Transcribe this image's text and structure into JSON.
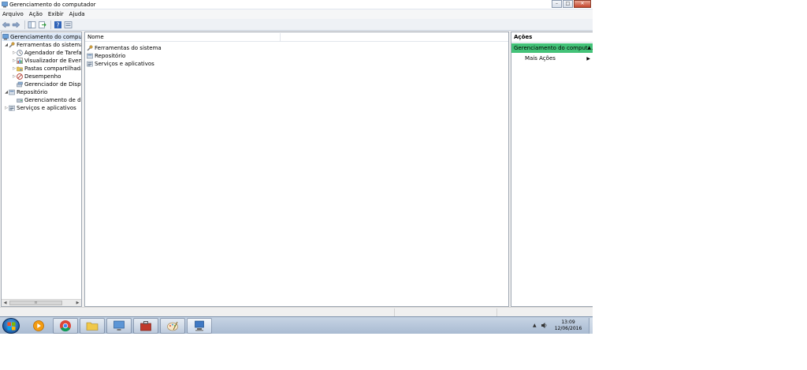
{
  "window": {
    "title": "Gerenciamento do computador",
    "buttons": {
      "minimize": "–",
      "maximize": "□",
      "close": "✕"
    }
  },
  "menu": [
    "Arquivo",
    "Ação",
    "Exibir",
    "Ajuda"
  ],
  "toolbar": {
    "icons": [
      "back-arrow-icon",
      "forward-arrow-icon",
      "show-hide-tree-icon",
      "export-list-icon",
      "help-icon",
      "properties-icon"
    ]
  },
  "tree": {
    "root": "Gerenciamento do computado",
    "items": [
      {
        "label": "Ferramentas do sistema",
        "level": 1,
        "expanded": true,
        "icon": "tools-icon"
      },
      {
        "label": "Agendador de Tarefas",
        "level": 2,
        "icon": "clock-icon"
      },
      {
        "label": "Visualizador de Eventos",
        "level": 2,
        "icon": "event-viewer-icon"
      },
      {
        "label": "Pastas compartilhadas",
        "level": 2,
        "icon": "shared-folder-icon"
      },
      {
        "label": "Desempenho",
        "level": 2,
        "icon": "performance-icon"
      },
      {
        "label": "Gerenciador de Disposit",
        "level": 2,
        "icon": "device-manager-icon"
      },
      {
        "label": "Repositório",
        "level": 1,
        "expanded": true,
        "icon": "storage-icon"
      },
      {
        "label": "Gerenciamento de disco",
        "level": 2,
        "icon": "disk-icon"
      },
      {
        "label": "Serviços e aplicativos",
        "level": 1,
        "expanded": false,
        "icon": "services-icon"
      }
    ]
  },
  "list": {
    "column": "Nome",
    "items": [
      {
        "label": "Ferramentas do sistema",
        "icon": "tools-icon"
      },
      {
        "label": "Repositório",
        "icon": "storage-icon"
      },
      {
        "label": "Serviços e aplicativos",
        "icon": "services-icon"
      }
    ]
  },
  "actions": {
    "title": "Ações",
    "section": "Gerenciamento do comput...",
    "more": "Mais Ações"
  },
  "taskbar": {
    "pinned": [
      "chrome-icon",
      "folder-icon",
      "network-monitor-icon",
      "toolbox-icon",
      "paint-icon",
      "computer-management-icon"
    ],
    "clock_time": "13:09",
    "clock_date": "12/06/2016"
  },
  "colors": {
    "actions_highlight": "#43c278",
    "selection": "#dbe7f6",
    "taskbar": "#b7c7db"
  }
}
